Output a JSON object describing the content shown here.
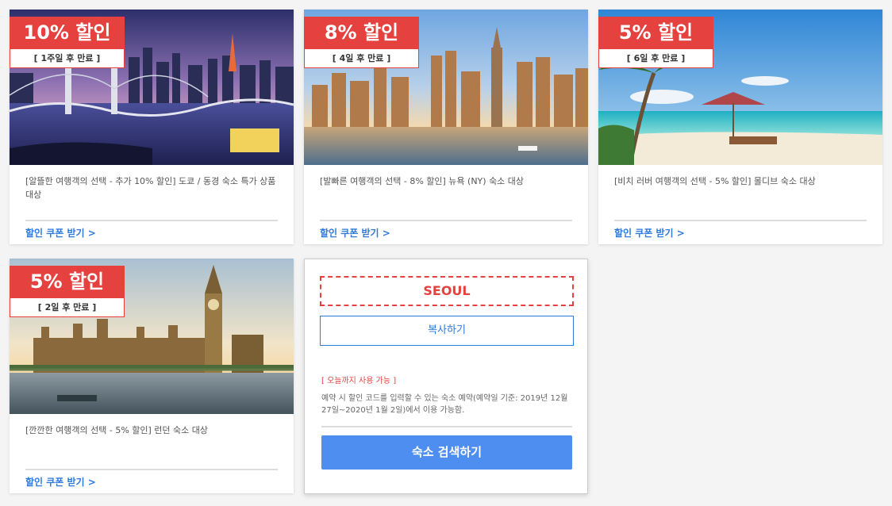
{
  "cards": [
    {
      "discount": "10% 할인",
      "expiry": "[ 1주일 후 만료 ]",
      "description": "[알뜰한 여행객의 선택 - 추가 10% 할인] 도쿄 / 동경 숙소 특가 상품 대상",
      "link": "할인 쿠폰 받기 >"
    },
    {
      "discount": "8% 할인",
      "expiry": "[ 4일 후 만료 ]",
      "description": "[발빠른 여행객의 선택 - 8% 할인] 뉴욕 (NY) 숙소 대상",
      "link": "할인 쿠폰 받기 >"
    },
    {
      "discount": "5% 할인",
      "expiry": "[ 6일 후 만료 ]",
      "description": "[비치 러버 여행객의 선택 - 5% 할인] 몰디브 숙소 대상",
      "link": "할인 쿠폰 받기 >"
    },
    {
      "discount": "5% 할인",
      "expiry": "[ 2일 후 만료 ]",
      "description": "[깐깐한 여행객의 선택 - 5% 할인] 런던 숙소 대상",
      "link": "할인 쿠폰 받기 >"
    }
  ],
  "coupon": {
    "code": "SEOUL",
    "copy_label": "복사하기",
    "validity": "[ 오늘까지 사용 가능 ]",
    "note": "예약 시 할인 코드를 입력할 수 있는 숙소 예약(예약일 기준: 2019년 12월 27일~2020년 1월 2일)에서 이용 가능함.",
    "search_label": "숙소 검색하기"
  },
  "colors": {
    "badge": "#e5413f",
    "link": "#2f7bdc",
    "button": "#4d8ef0"
  }
}
